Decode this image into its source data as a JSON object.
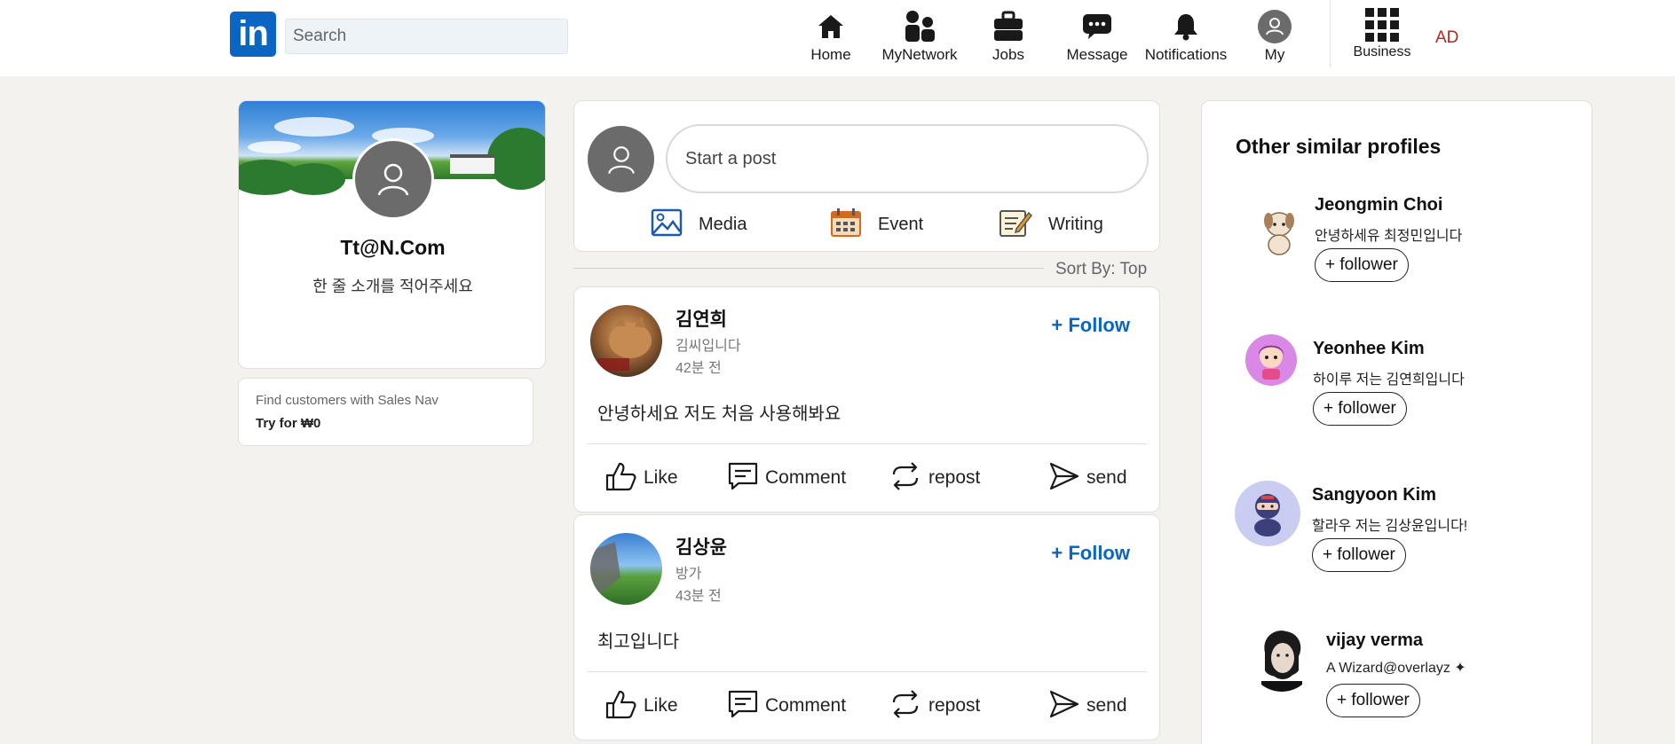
{
  "header": {
    "logo_text": "in",
    "search_placeholder": "Search",
    "nav": [
      {
        "label": "Home",
        "icon": "home-icon"
      },
      {
        "label": "MyNetwork",
        "icon": "network-icon"
      },
      {
        "label": "Jobs",
        "icon": "briefcase-icon"
      },
      {
        "label": "Message",
        "icon": "message-icon"
      },
      {
        "label": "Notifications",
        "icon": "bell-icon"
      },
      {
        "label": "My",
        "icon": "avatar-icon"
      },
      {
        "label": "Business",
        "icon": "grid-icon"
      }
    ],
    "ad_label": "AD"
  },
  "profile": {
    "name": "Tt@N.Com",
    "bio": "한 줄 소개를 적어주세요"
  },
  "sales_nav": {
    "text": "Find customers with Sales Nav",
    "cta": "Try for ₩0"
  },
  "composer": {
    "placeholder": "Start a post",
    "actions": [
      {
        "label": "Media",
        "icon": "media-icon"
      },
      {
        "label": "Event",
        "icon": "calendar-icon"
      },
      {
        "label": "Writing",
        "icon": "writing-icon"
      }
    ]
  },
  "sort": {
    "label": "Sort By: Top"
  },
  "posts": [
    {
      "author": "김연희",
      "subtitle": "김씨입니다",
      "time": "42분 전",
      "follow_label": "+ Follow",
      "body": "안녕하세요 저도 처음 사용해봐요"
    },
    {
      "author": "김상윤",
      "subtitle": "방가",
      "time": "43분 전",
      "follow_label": "+ Follow",
      "body": "최고입니다"
    }
  ],
  "post_actions": [
    "Like",
    "Comment",
    "repost",
    "send"
  ],
  "similar": {
    "title": "Other similar profiles",
    "profiles": [
      {
        "name": "Jeongmin Choi",
        "bio": "안녕하세유 최정민입니다",
        "button": "+ follower"
      },
      {
        "name": "Yeonhee Kim",
        "bio": "하이루 저는 김연희입니다",
        "button": "+ follower"
      },
      {
        "name": "Sangyoon Kim",
        "bio": "할라우 저는 김상윤입니다!",
        "button": "+ follower"
      },
      {
        "name": "vijay verma",
        "bio": "A Wizard@overlayz ✦",
        "button": "+ follower"
      }
    ]
  },
  "colors": {
    "brand": "#0a66c2",
    "ad": "#b3261e",
    "background": "#f3f2ef"
  }
}
